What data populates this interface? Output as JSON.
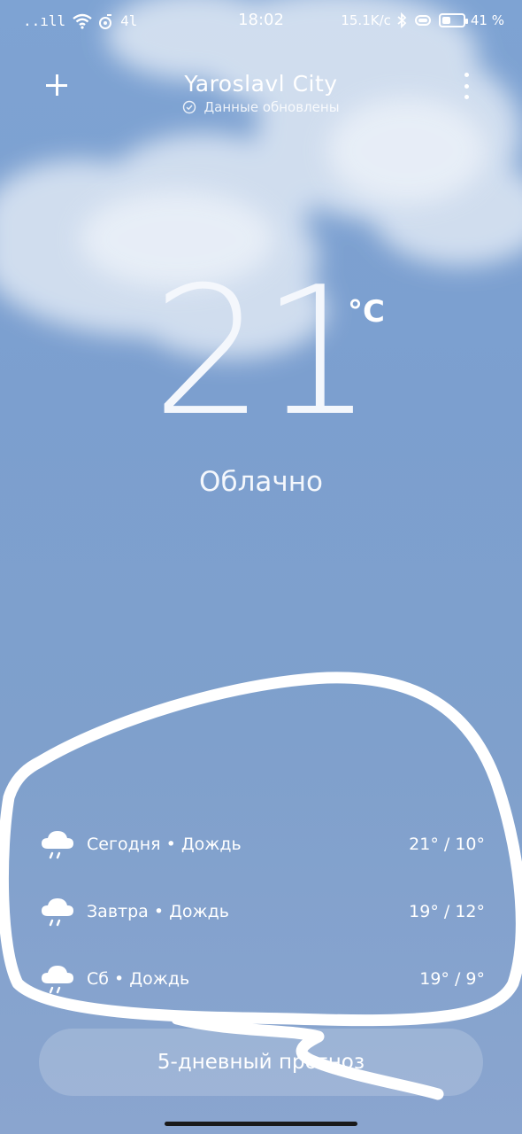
{
  "status_bar": {
    "signal": "..ıll",
    "speed_badge": "4l",
    "time": "18:02",
    "net_speed": "15.1K/c",
    "battery_level": 0.41,
    "battery_text": "41 %"
  },
  "header": {
    "city": "Yaroslavl City",
    "updated_text": "Данные обновлены"
  },
  "current": {
    "temperature": "21",
    "unit": "°C",
    "condition": "Облачно"
  },
  "forecast": [
    {
      "label": "Сегодня • Дождь",
      "temps": "21° / 10°",
      "icon": "rain-cloud-icon"
    },
    {
      "label": "Завтра • Дождь",
      "temps": "19° / 12°",
      "icon": "rain-cloud-icon"
    },
    {
      "label": "Сб • Дождь",
      "temps": "19° / 9°",
      "icon": "rain-cloud-icon"
    }
  ],
  "five_day_button": "5-дневный прогноз",
  "colors": {
    "sky_top": "#7ea3d3",
    "sky_bottom": "#8aa5cf",
    "annotation": "#ffffff"
  }
}
